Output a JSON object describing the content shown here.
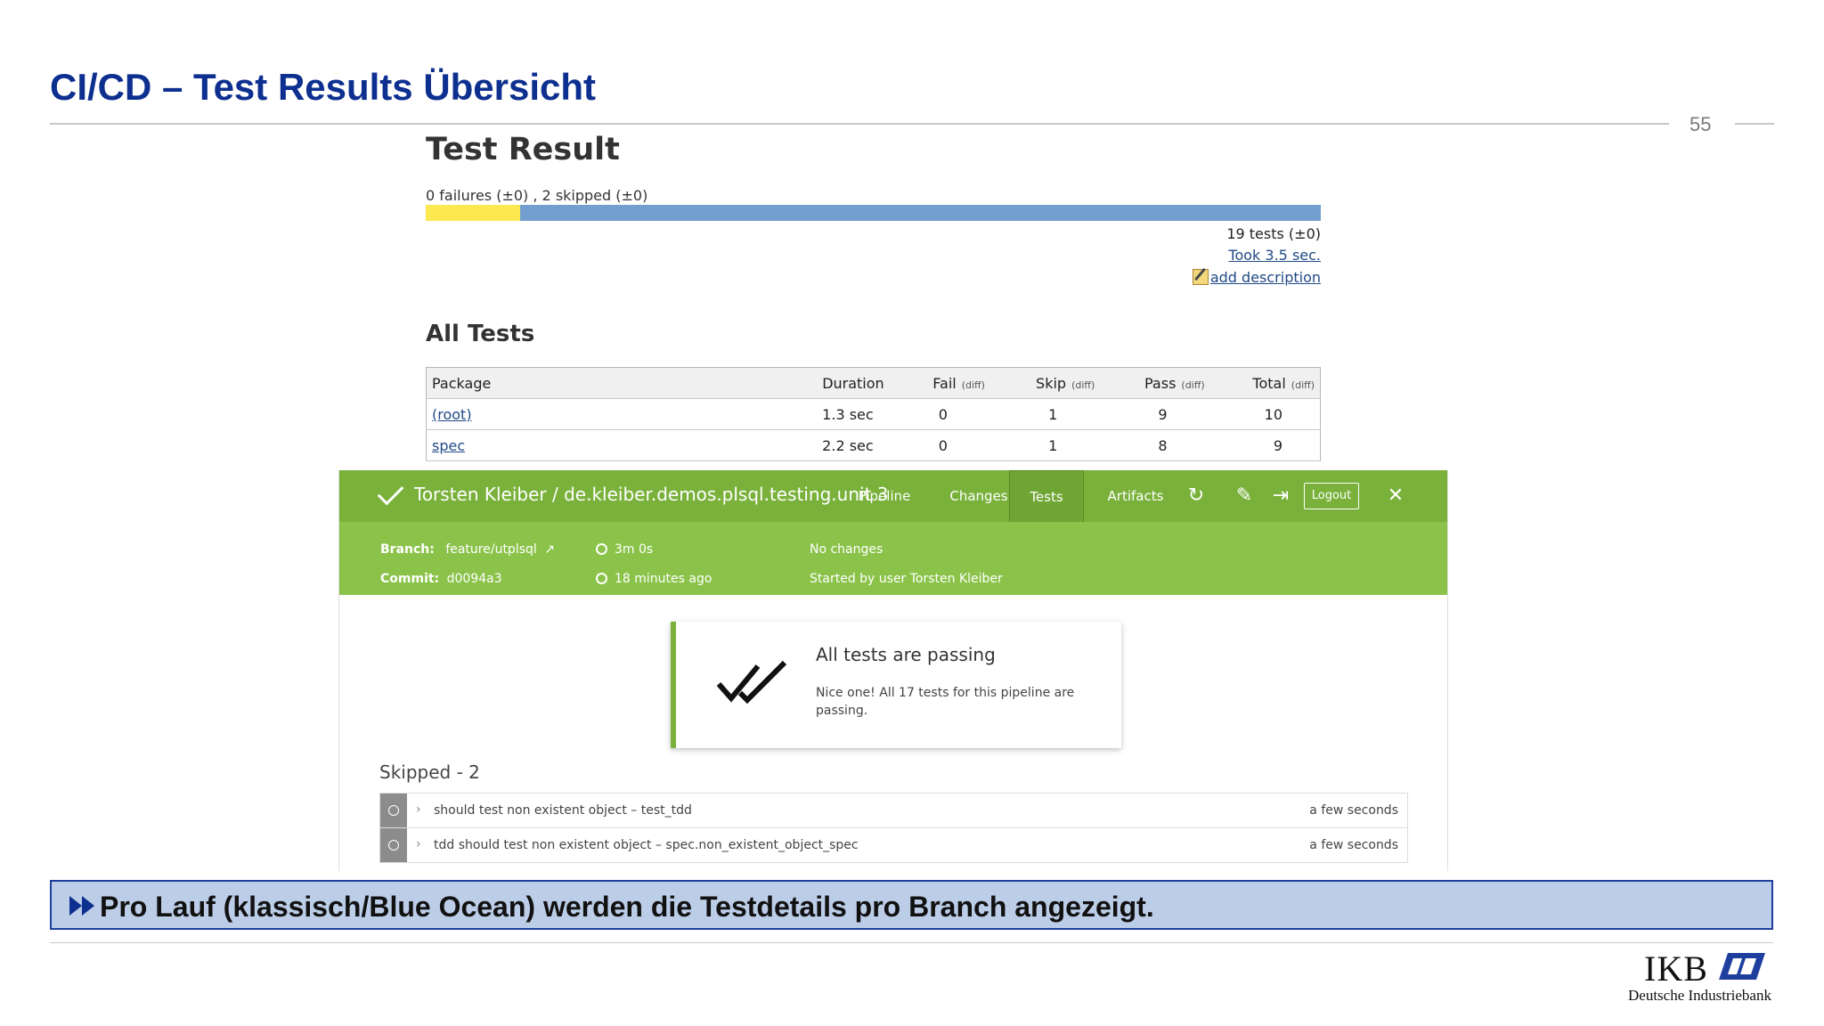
{
  "slide": {
    "title": "CI/CD – Test Results Übersicht",
    "page_number": "55",
    "callout": "Pro Lauf (klassisch/Blue Ocean) werden die Testdetails pro Branch angezeigt.",
    "logo": "IKB",
    "bank_name": "Deutsche Industriebank"
  },
  "jenkins_classic": {
    "title": "Test Result",
    "summary": "0 failures (±0) , 2 skipped (±0)",
    "skip_fraction": 0.105,
    "tests_count": "19 tests (±0)",
    "took": "Took 3.5 sec.",
    "add_description": "add description",
    "all_tests_heading": "All Tests",
    "columns": [
      "Package",
      "Duration",
      "Fail",
      "Skip",
      "Pass",
      "Total"
    ],
    "diff_label": "(diff)",
    "rows": [
      {
        "package": "(root)",
        "duration": "1.3 sec",
        "fail": "0",
        "skip": "1",
        "pass": "9",
        "total": "10"
      },
      {
        "package": "spec",
        "duration": "2.2 sec",
        "fail": "0",
        "skip": "1",
        "pass": "8",
        "total": "9"
      }
    ]
  },
  "blue_ocean": {
    "title": "Torsten Kleiber / de.kleiber.demos.plsql.testing.unit 3",
    "tabs": [
      "Pipeline",
      "Changes",
      "Tests",
      "Artifacts"
    ],
    "active_tab": "Tests",
    "logout": "Logout",
    "branch_label": "Branch:",
    "branch_value": "feature/utplsql",
    "commit_label": "Commit:",
    "commit_value": "d0094a3",
    "duration": "3m 0s",
    "time_ago": "18 minutes ago",
    "changes": "No changes",
    "started_by": "Started by user Torsten Kleiber",
    "passing_title": "All tests are passing",
    "passing_text": "Nice one! All 17 tests for this pipeline are passing.",
    "skipped_heading": "Skipped - 2",
    "skipped": [
      {
        "name": "should test non existent object – test_tdd",
        "time": "a few seconds"
      },
      {
        "name": "tdd should test non existent object – spec.non_existent_object_spec",
        "time": "a few seconds"
      }
    ]
  },
  "colors": {
    "title_blue": "#0d2f8f",
    "jenkins_bar_blue": "#729fcf",
    "jenkins_bar_yellow": "#fce94f",
    "blue_ocean_green": "#79b13b",
    "callout_bg": "#bccde8"
  },
  "icons": [
    "check-icon",
    "rerun-icon",
    "edit-icon",
    "exit-icon",
    "close-icon",
    "external-link-icon",
    "double-check-icon",
    "chevron-right-icon",
    "note-icon",
    "double-arrow-icon"
  ]
}
